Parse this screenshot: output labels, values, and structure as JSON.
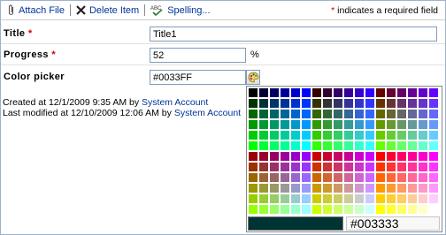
{
  "toolbar": {
    "attach_label": "Attach File",
    "delete_label": "Delete Item",
    "spelling_label": "Spelling...",
    "required_asterisk": "*",
    "required_note": " indicates a required field"
  },
  "form": {
    "title": {
      "label": "Title",
      "required_mark": " *",
      "value": "Title1"
    },
    "progress": {
      "label": "Progress",
      "required_mark": " *",
      "value": "52",
      "unit": "%"
    },
    "color": {
      "label": "Color picker",
      "value": "#0033FF"
    }
  },
  "meta": {
    "created_prefix": "Created at 12/1/2009 9:35 AM  by ",
    "created_by": "System Account",
    "modified_prefix": "Last modified at 12/10/2009 12:06 AM  by ",
    "modified_by": "System Account"
  },
  "palette": {
    "hover_color": "#003333",
    "hover_hex": "#003333",
    "columns": 18,
    "rows": 12
  },
  "colors": {
    "link": "#003399",
    "required": "#cc0000",
    "border": "#7f9db9"
  }
}
